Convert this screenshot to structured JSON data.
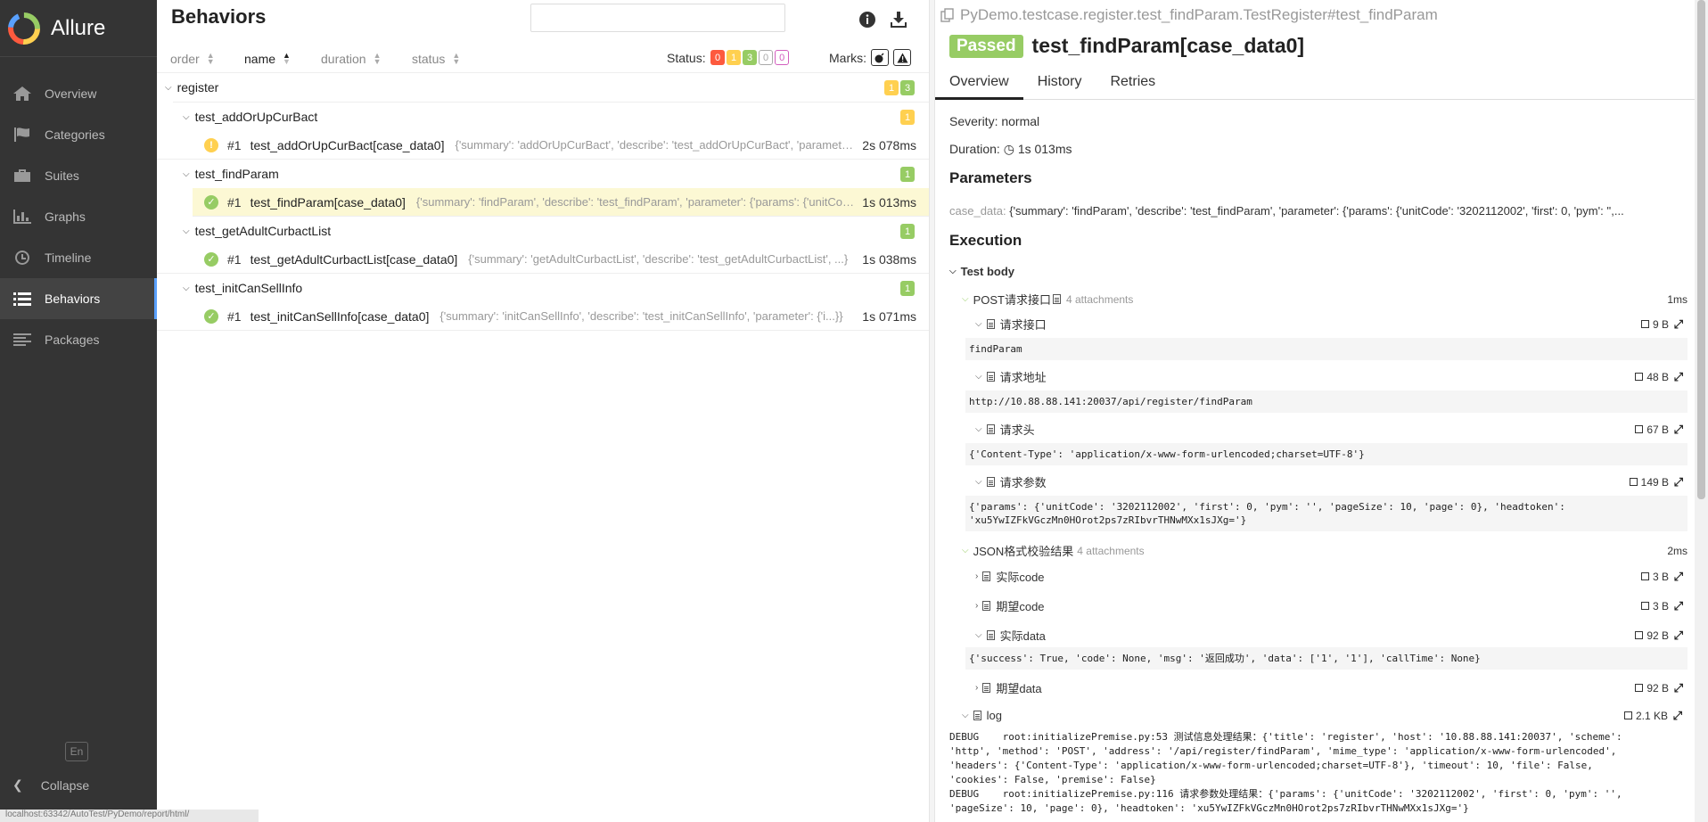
{
  "app": {
    "name": "Allure"
  },
  "sidebar": {
    "items": [
      {
        "label": "Overview"
      },
      {
        "label": "Categories"
      },
      {
        "label": "Suites"
      },
      {
        "label": "Graphs"
      },
      {
        "label": "Timeline"
      },
      {
        "label": "Behaviors"
      },
      {
        "label": "Packages"
      }
    ],
    "lang": "En",
    "collapse": "Collapse"
  },
  "statusbar": {
    "text": "localhost:63342/AutoTest/PyDemo/report/html/"
  },
  "behaviors": {
    "title": "Behaviors",
    "search_placeholder": "",
    "sort": {
      "order": "order",
      "name": "name",
      "duration": "duration",
      "status": "status"
    },
    "status_label": "Status:",
    "status_counts": {
      "failed": "0",
      "broken": "1",
      "passed": "3",
      "skipped": "0",
      "unknown": "0"
    },
    "marks_label": "Marks:",
    "group": {
      "name": "register",
      "broken": "1",
      "passed": "3"
    },
    "features": [
      {
        "name": "test_addOrUpCurBact",
        "count": "1",
        "num": "#1",
        "test": "test_addOrUpCurBact[case_data0]",
        "params": "{'summary': 'addOrUpCurBact', 'describe': 'test_addOrUpCurBact', 'parameter': {'params': {...}}}",
        "duration": "2s 078ms"
      },
      {
        "name": "test_findParam",
        "count": "1",
        "num": "#1",
        "test": "test_findParam[case_data0]",
        "params": "{'summary': 'findParam', 'describe': 'test_findParam', 'parameter': {'params': {'unitCode': ...}}}",
        "duration": "1s 013ms"
      },
      {
        "name": "test_getAdultCurbactList",
        "count": "1",
        "num": "#1",
        "test": "test_getAdultCurbactList[case_data0]",
        "params": "{'summary': 'getAdultCurbactList', 'describe': 'test_getAdultCurbactList', ...}",
        "duration": "1s 038ms"
      },
      {
        "name": "test_initCanSellInfo",
        "count": "1",
        "num": "#1",
        "test": "test_initCanSellInfo[case_data0]",
        "params": "{'summary': 'initCanSellInfo', 'describe': 'test_initCanSellInfo', 'parameter': {'i...}}",
        "duration": "1s 071ms"
      }
    ]
  },
  "detail": {
    "breadcrumb": "PyDemo.testcase.register.test_findParam.TestRegister#test_findParam",
    "status": "Passed",
    "title": "test_findParam[case_data0]",
    "tabs": [
      "Overview",
      "History",
      "Retries"
    ],
    "severity_label": "Severity:",
    "severity": "normal",
    "duration_label": "Duration:",
    "duration": "1s 013ms",
    "parameters_heading": "Parameters",
    "param_name": "case_data:",
    "param_value": "{'summary': 'findParam', 'describe': 'test_findParam', 'parameter': {'params': {'unitCode': '3202112002', 'first': 0, 'pym': '',...",
    "execution_heading": "Execution",
    "test_body": "Test body",
    "step1": {
      "name": "POST请求接口",
      "attachments": "4 attachments",
      "time": "1ms"
    },
    "att": [
      {
        "name": "请求接口",
        "size": "9 B",
        "content": "findParam"
      },
      {
        "name": "请求地址",
        "size": "48 B",
        "content": "http://10.88.88.141:20037/api/register/findParam"
      },
      {
        "name": "请求头",
        "size": "67 B",
        "content": "{'Content-Type': 'application/x-www-form-urlencoded;charset=UTF-8'}"
      },
      {
        "name": "请求参数",
        "size": "149 B",
        "content": "{'params': {'unitCode': '3202112002', 'first': 0, 'pym': '', 'pageSize': 10, 'page': 0}, 'headtoken':\n'xu5YwIZFkVGczMn0HOrot2ps7zRIbvrTHNwMXx1sJXg='}"
      }
    ],
    "step2": {
      "name": "JSON格式校验结果",
      "attachments": "4 attachments",
      "time": "2ms"
    },
    "att2": [
      {
        "name": "实际code",
        "size": "3 B"
      },
      {
        "name": "期望code",
        "size": "3 B"
      },
      {
        "name": "实际data",
        "size": "92 B",
        "content": "{'success': True, 'code': None, 'msg': '返回成功', 'data': ['1', '1'], 'callTime': None}"
      },
      {
        "name": "期望data",
        "size": "92 B"
      }
    ],
    "log": {
      "name": "log",
      "size": "2.1 KB",
      "content": "DEBUG    root:initializePremise.py:53 测试信息处理结果：{'title': 'register', 'host': '10.88.88.141:20037', 'scheme':\n'http', 'method': 'POST', 'address': '/api/register/findParam', 'mime_type': 'application/x-www-form-urlencoded',\n'headers': {'Content-Type': 'application/x-www-form-urlencoded;charset=UTF-8'}, 'timeout': 10, 'file': False,\n'cookies': False, 'premise': False}\nDEBUG    root:initializePremise.py:116 请求参数处理结果：{'params': {'unitCode': '3202112002', 'first': 0, 'pym': '',\n'pageSize': 10, 'page': 0}, 'headtoken': 'xu5YwIZFkVGczMn0HOrot2ps7zRIbvrTHNwMXx1sJXg='}"
    }
  }
}
